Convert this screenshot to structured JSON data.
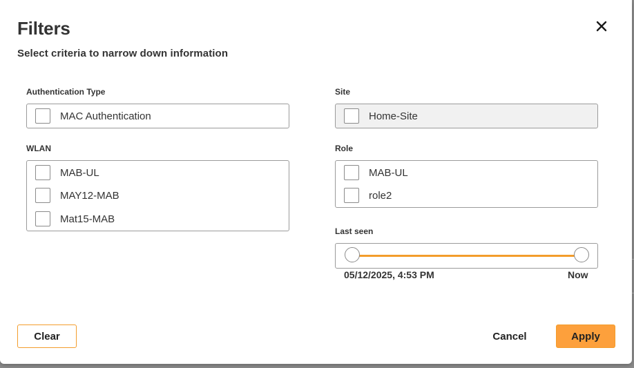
{
  "dialog": {
    "title": "Filters",
    "subtitle": "Select criteria to narrow down information",
    "close_icon": "close-icon"
  },
  "authentication_type": {
    "label": "Authentication Type",
    "options": [
      {
        "label": "MAC Authentication",
        "checked": false
      }
    ]
  },
  "site": {
    "label": "Site",
    "disabled": true,
    "options": [
      {
        "label": "Home-Site",
        "checked": false
      }
    ]
  },
  "wlan": {
    "label": "WLAN",
    "options": [
      {
        "label": "MAB-UL",
        "checked": false
      },
      {
        "label": "MAY12-MAB",
        "checked": false
      },
      {
        "label": "Mat15-MAB",
        "checked": false
      }
    ]
  },
  "role": {
    "label": "Role",
    "options": [
      {
        "label": "MAB-UL",
        "checked": false
      },
      {
        "label": "role2",
        "checked": false
      }
    ]
  },
  "last_seen": {
    "label": "Last seen",
    "start_label": "05/12/2025, 4:53 PM",
    "end_label": "Now",
    "range": [
      0,
      1
    ]
  },
  "footer": {
    "clear_label": "Clear",
    "cancel_label": "Cancel",
    "apply_label": "Apply"
  },
  "colors": {
    "accent": "#fda03c",
    "accent_border": "#f39c2b",
    "slider_fill": "#f39c2b"
  }
}
